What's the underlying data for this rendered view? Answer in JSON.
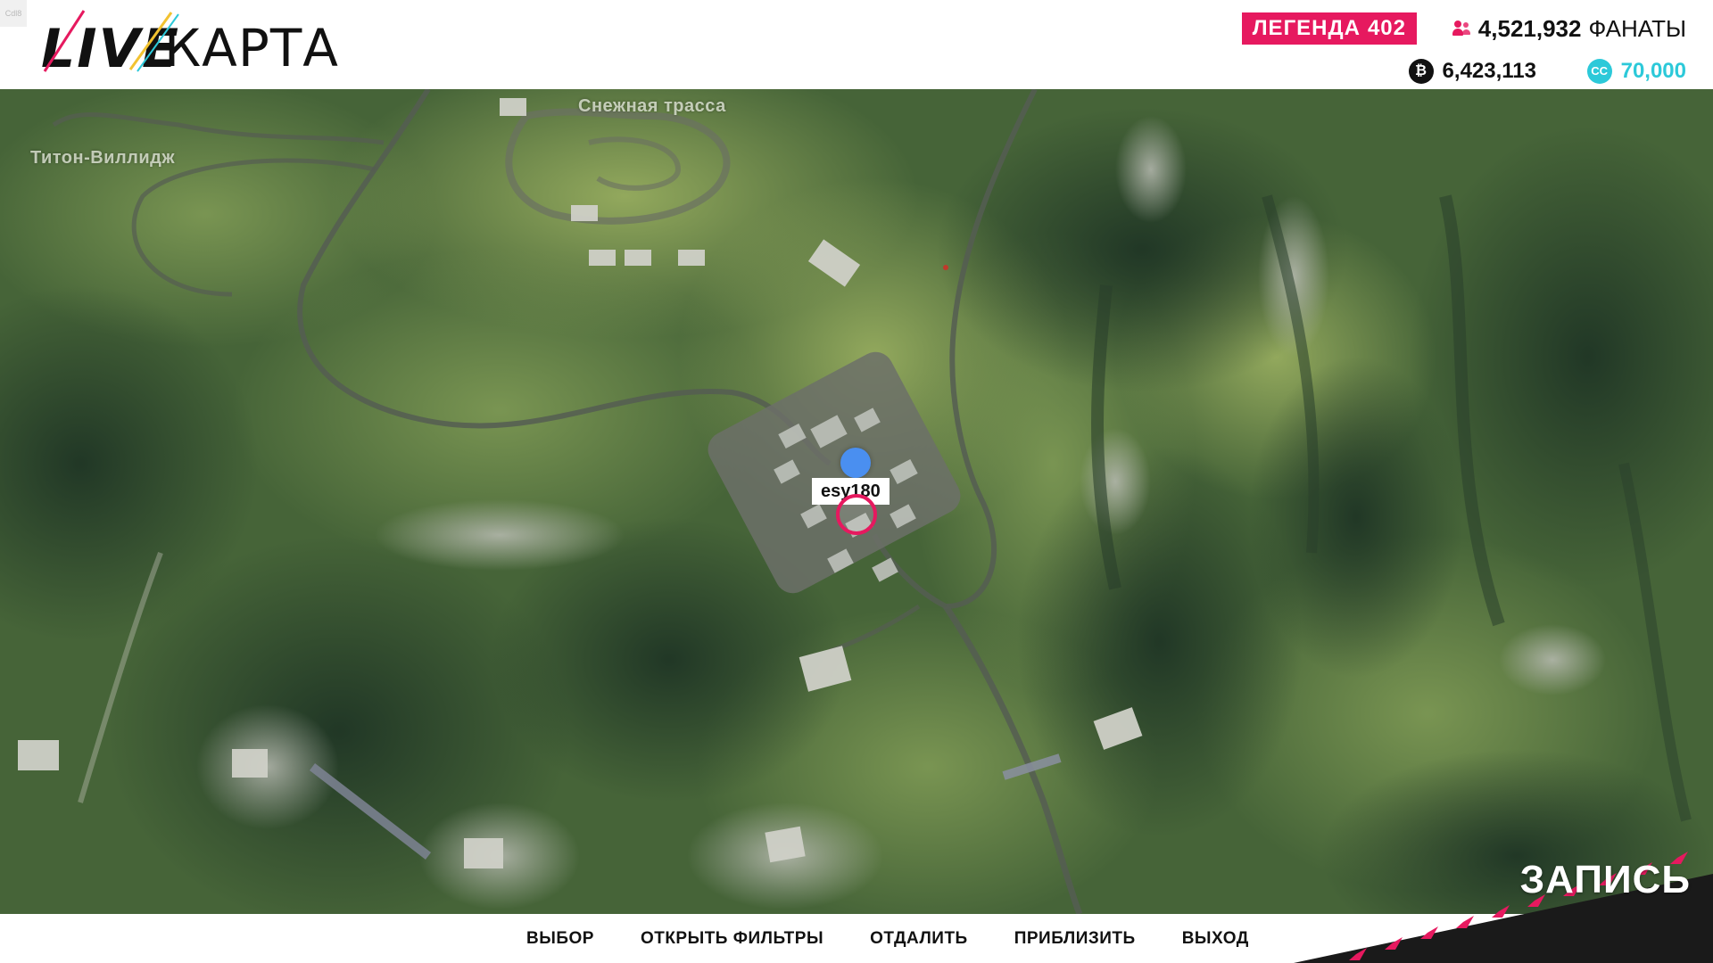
{
  "corner_tag": "Cdl8",
  "header": {
    "logo_live": "LIVE",
    "logo_map": "КАРТА",
    "rank_label": "ЛЕГЕНДА",
    "rank_value": "402",
    "fans_count": "4,521,932",
    "fans_label": "ФАНАТЫ",
    "credits": "6,423,113",
    "forza_points": "70,000",
    "credits_icon": "credits-icon",
    "forza_icon": "forza-points-icon",
    "fans_icon": "fans-icon",
    "colors": {
      "accent": "#e6195f",
      "forza": "#2cc9d9"
    }
  },
  "map": {
    "labels": {
      "snow_track": "Снежная трасса",
      "village": "Титон-Виллидж"
    },
    "player_name": "esy180"
  },
  "bottom": {
    "actions": [
      {
        "label": "ВЫБОР"
      },
      {
        "label": "ОТКРЫТЬ ФИЛЬТРЫ"
      },
      {
        "label": "ОТДАЛИТЬ"
      },
      {
        "label": "ПРИБЛИЗИТЬ"
      },
      {
        "label": "ВЫХОД"
      }
    ],
    "record_label": "ЗАПИСЬ"
  }
}
